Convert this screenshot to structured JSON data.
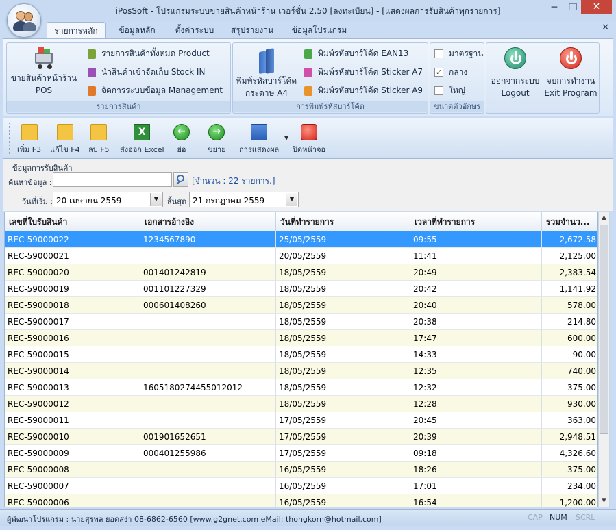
{
  "window": {
    "title": "iPosSoft - โปรแกรมระบบขายสินค้าหน้าร้าน เวอร์ชั่น 2.50 [ลงทะเบียน] - [แสดงผลการรับสินค้าทุกรายการ]",
    "close_glyph": "✕",
    "ribbon_close_glyph": "✕"
  },
  "ribbon": {
    "tabs": [
      "รายการหลัก",
      "ข้อมูลหลัก",
      "ตั้งค่าระบบ",
      "สรุปรายงาน",
      "ข้อมูลโปรแกรม"
    ],
    "groups": {
      "products": {
        "label": "รายการสินค้า",
        "pos_label_1": "ขายสินค้าหน้าร้าน",
        "pos_label_2": "POS",
        "items": [
          "รายการสินค้าทั้งหมด Product",
          "นำสินค้าเข้าจัดเก็บ Stock IN",
          "จัดการระบบข้อมูล Management"
        ]
      },
      "barcode": {
        "label": "การพิมพ์รหัสบาร์โค้ด",
        "a4_label_1": "พิมพ์รหัสบาร์โค้ด",
        "a4_label_2": "กระดาษ A4",
        "items": [
          "พิมพ์รหัสบาร์โค้ด EAN13",
          "พิมพ์รหัสบาร์โค้ด Sticker A7",
          "พิมพ์รหัสบาร์โค้ด Sticker A9"
        ]
      },
      "fontsize": {
        "label": "ขนาดตัวอักษร",
        "options": [
          "มาตรฐาน",
          "กลาง",
          "ใหญ่"
        ],
        "checked_mark": "✓"
      },
      "exit": {
        "logout_1": "ออกจากระบบ",
        "logout_2": "Logout",
        "exit_1": "จบการทำงาน",
        "exit_2": "Exit Program"
      }
    }
  },
  "toolbar": {
    "add": "เพิ่ม F3",
    "edit": "แก้ไข F4",
    "delete": "ลบ F5",
    "export": "ส่งออก Excel",
    "shrink": "ย่อ",
    "expand": "ขยาย",
    "display": "การแสดงผล",
    "close": "ปิดหน้าจอ",
    "excel_glyph": "X",
    "left_glyph": "←",
    "right_glyph": "→",
    "drop_glyph": "▼"
  },
  "filter": {
    "section_title": "ข้อมูลการรับสินค้า",
    "search_label": "ค้นหาข้อมูล :",
    "search_value": "",
    "count_text": "[จำนวน : 22 รายการ.]",
    "start_label": "วันที่เริ่ม :",
    "start_value": "20   เมษายน     2559",
    "end_label": "สิ้นสุด",
    "end_value": "21   กรกฎาคม     2559",
    "drop_glyph": "▼"
  },
  "grid": {
    "columns": [
      "เลขที่ใบรับสินค้า",
      "เอกสารอ้างอิง",
      "วันที่ทำรายการ",
      "เวลาที่ทำรายการ",
      "รวมจำนว..."
    ],
    "rows": [
      [
        "REC-59000022",
        "1234567890",
        "25/05/2559",
        "09:55",
        "2,672.58"
      ],
      [
        "REC-59000021",
        "",
        "20/05/2559",
        "11:41",
        "2,125.00"
      ],
      [
        "REC-59000020",
        "001401242819",
        "18/05/2559",
        "20:49",
        "2,383.54"
      ],
      [
        "REC-59000019",
        "001101227329",
        "18/05/2559",
        "20:42",
        "1,141.92"
      ],
      [
        "REC-59000018",
        "000601408260",
        "18/05/2559",
        "20:40",
        "578.00"
      ],
      [
        "REC-59000017",
        "",
        "18/05/2559",
        "20:38",
        "214.80"
      ],
      [
        "REC-59000016",
        "",
        "18/05/2559",
        "17:47",
        "600.00"
      ],
      [
        "REC-59000015",
        "",
        "18/05/2559",
        "14:33",
        "90.00"
      ],
      [
        "REC-59000014",
        "",
        "18/05/2559",
        "12:35",
        "740.00"
      ],
      [
        "REC-59000013",
        "1605180274455012012",
        "18/05/2559",
        "12:32",
        "375.00"
      ],
      [
        "REC-59000012",
        "",
        "18/05/2559",
        "12:28",
        "930.00"
      ],
      [
        "REC-59000011",
        "",
        "17/05/2559",
        "20:45",
        "363.00"
      ],
      [
        "REC-59000010",
        "001901652651",
        "17/05/2559",
        "20:39",
        "2,948.51"
      ],
      [
        "REC-59000009",
        "000401255986",
        "17/05/2559",
        "09:18",
        "4,326.60"
      ],
      [
        "REC-59000008",
        "",
        "16/05/2559",
        "18:26",
        "375.00"
      ],
      [
        "REC-59000007",
        "",
        "16/05/2559",
        "17:01",
        "234.00"
      ],
      [
        "REC-59000006",
        "",
        "16/05/2559",
        "16:54",
        "1,200.00"
      ]
    ],
    "selected_row": 0,
    "scroll_up": "▲",
    "scroll_down": "▼"
  },
  "status": {
    "developer": "ผู้พัฒนาโปรแกรม : นายสุรพล ยอดสง่า 08-6862-6560 [www.g2gnet.com  eMail: thongkorn@hotmail.com]",
    "caps": "CAP",
    "num": "NUM",
    "scrl": "SCRL"
  },
  "colors": {
    "selected_row": "#3399ff",
    "odd_row": "#fafae4",
    "ribbon_bg": "#dbe8f7",
    "close_button": "#c7463b"
  }
}
